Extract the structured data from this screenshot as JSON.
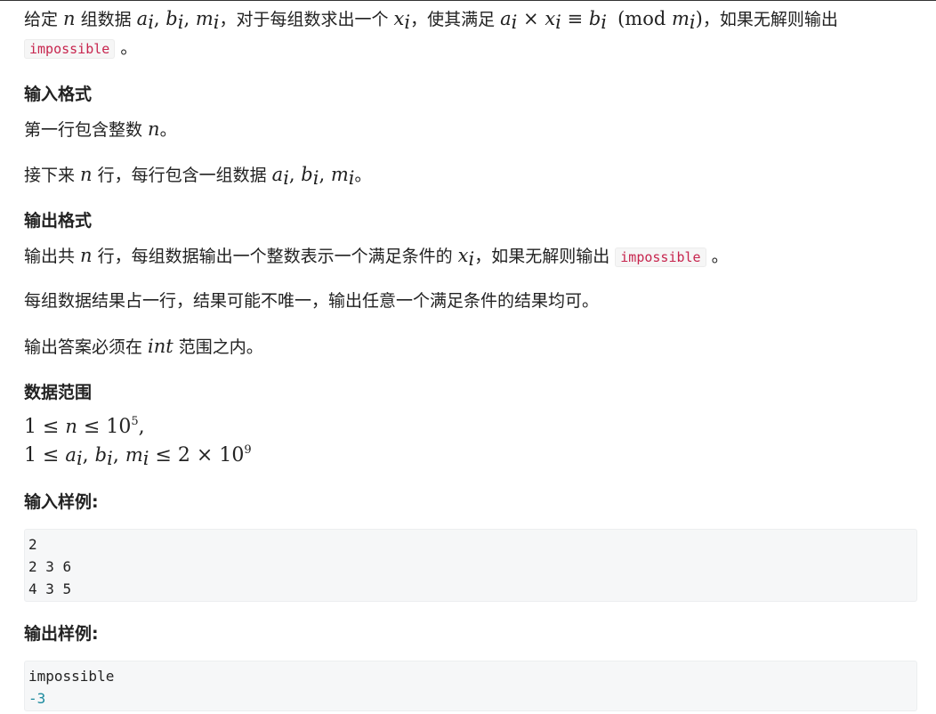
{
  "intro": {
    "t1": "给定 ",
    "n": "n",
    "t2": " 组数据 ",
    "a": "a",
    "b": "b",
    "mm": "m",
    "i": "i",
    "t3": "，对于每组数求出一个 ",
    "x": "x",
    "t4": "，使其满足 ",
    "times": " × ",
    "equiv": " ≡ ",
    "mod": "(mod ",
    "close": ")",
    "t5": "，如果无解则输出",
    "code": "impossible",
    "period": "。"
  },
  "input_heading": "输入格式",
  "input_line1": {
    "t1": "第一行包含整数 ",
    "var": "n",
    "t2": "。"
  },
  "input_line2": {
    "t1": "接下来 ",
    "var": "n",
    "t2": " 行，每行包含一组数据 ",
    "t3": "。"
  },
  "output_heading": "输出格式",
  "output_line1": {
    "t1": "输出共 ",
    "var": "n",
    "t2": " 行，每组数据输出一个整数表示一个满足条件的 ",
    "t3": "，如果无解则输出 ",
    "code": "impossible",
    "t4": "。"
  },
  "output_line2": "每组数据结果占一行，结果可能不唯一，输出任意一个满足条件的结果均可。",
  "output_line3": {
    "t1": "输出答案必须在 ",
    "var": "int",
    "t2": " 范围之内。"
  },
  "range_heading": "数据范围",
  "range": {
    "r1": {
      "pre": "1 ≤ ",
      "var": "n",
      "mid": " ≤ 10",
      "exp": "5",
      "post": ","
    },
    "r2": {
      "pre": "1 ≤ ",
      "post": " ≤ 2 × 10",
      "exp": "9"
    }
  },
  "sample_input_heading": "输入样例:",
  "sample_input": [
    "2",
    "2 3 6",
    "4 3 5"
  ],
  "sample_output_heading": "输出样例:",
  "sample_output": [
    "impossible",
    "-3"
  ]
}
